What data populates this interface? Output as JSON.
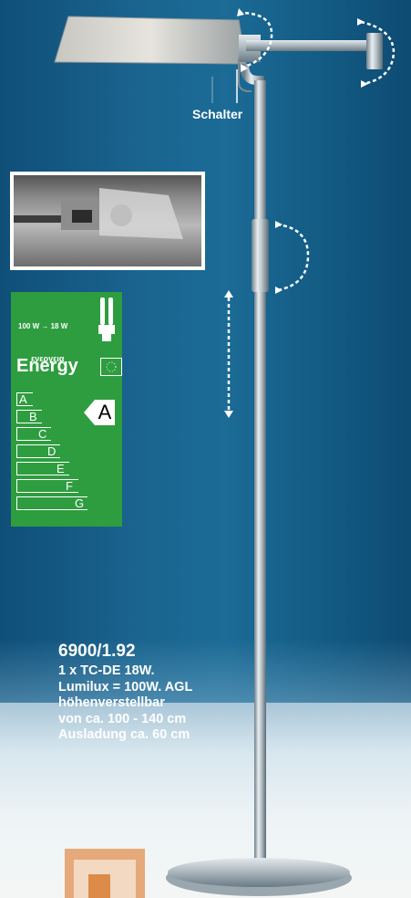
{
  "product": {
    "switch_label": "Schalter",
    "model_number": "6900/1.92",
    "spec_lines": [
      "1 x TC-DE 18W.",
      "Lumilux = 100W. AGL",
      "höhenverstellbar",
      "von ca. 100 - 140 cm",
      "Ausladung ca. 60 cm"
    ]
  },
  "energy_label": {
    "wattage_text": "100 W → 18 W",
    "energy_word": "Energy",
    "greek_text": "ενεργεια",
    "rating": "A",
    "classes": [
      "A",
      "B",
      "C",
      "D",
      "E",
      "F",
      "G"
    ],
    "background_color": "#2e9d3f"
  },
  "icons": [
    "dashed-rotate-arrow-icon",
    "dashed-vertical-arrow-icon",
    "cfl-bulb-icon",
    "eu-flag-icon",
    "brand-logo-icon"
  ]
}
